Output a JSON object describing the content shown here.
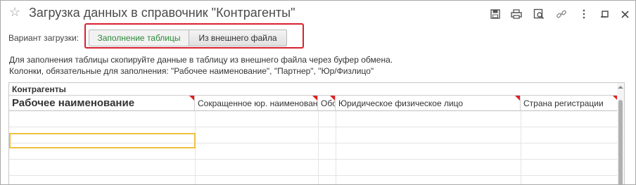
{
  "window": {
    "title": "Загрузка данных в справочник \"Контрагенты\"",
    "icons": [
      "star-icon",
      "save-icon",
      "print-icon",
      "preview-icon",
      "link-icon",
      "more-icon",
      "minimize-icon",
      "maximize-icon",
      "close-icon"
    ]
  },
  "variant": {
    "label": "Вариант загрузки:",
    "options": [
      "Заполнение таблицы",
      "Из внешнего файла"
    ],
    "selected": "Заполнение таблицы",
    "active_color": "#2c8a3a",
    "highlight_color": "#d9202f"
  },
  "info": {
    "line1": "Для заполнения таблицы скопируйте данные в таблицу из внешнего файла через буфер обмена.",
    "line2": "Колонки, обязательные для заполнения: \"Рабочее наименование\", \"Партнер\", \"Юр/Физлицо\""
  },
  "table": {
    "group_title": "Контрагенты",
    "columns": [
      "Рабочее наименование",
      "Сокращенное юр. наименование",
      "Обособленное подразделение",
      "Юридическое физическое лицо",
      "Страна регистрации"
    ],
    "required_marker_color": "#e02020"
  }
}
